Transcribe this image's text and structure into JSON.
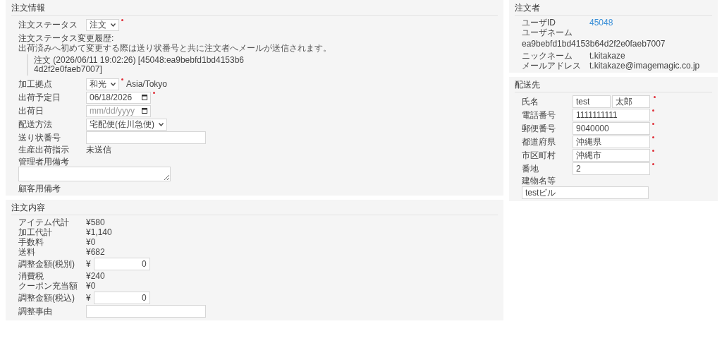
{
  "order_info": {
    "title": "注文情報",
    "fields": [
      {
        "kind": "select",
        "label": "注文ステータス",
        "value": "注文",
        "required": true
      },
      {
        "kind": "heading",
        "label": "注文ステータス変更履歴:"
      },
      {
        "kind": "note",
        "text": "出荷済みへ初めて変更する際は送り状番号と共に注文者へメールが送信されます。"
      },
      {
        "kind": "history",
        "text": "注文 (2026/06/11 19:02:26) [45048:ea9bebfd1bd4153b64d2f2e0faeb7007]"
      },
      {
        "kind": "select",
        "label": "加工拠点",
        "value": "和光",
        "required": true,
        "suffix": "Asia/Tokyo"
      },
      {
        "kind": "date",
        "label": "出荷予定日",
        "value": "06/18/2026",
        "required": true
      },
      {
        "kind": "date",
        "label": "出荷日",
        "placeholder": "mm/dd/yyyy",
        "required": false
      },
      {
        "kind": "select",
        "label": "配送方法",
        "value": "宅配便(佐川急便)",
        "required": false
      },
      {
        "kind": "input",
        "label": "送り状番号",
        "required": false
      },
      {
        "kind": "static",
        "label": "生産出荷指示",
        "value": "未送信"
      },
      {
        "kind": "textarea",
        "label": "管理者用備考"
      },
      {
        "kind": "heading",
        "label": "顧客用備考"
      }
    ]
  },
  "order_contents": {
    "title": "注文内容",
    "fields": [
      {
        "kind": "static",
        "label": "アイテム代計",
        "value": "¥580"
      },
      {
        "kind": "static",
        "label": "加工代計",
        "value": "¥1,140"
      },
      {
        "kind": "static",
        "label": "手数料",
        "value": "¥0"
      },
      {
        "kind": "static",
        "label": "送料",
        "value": "¥682"
      },
      {
        "kind": "money",
        "label": "調整金額(税別)",
        "prefix": "¥",
        "value": "0"
      },
      {
        "kind": "static",
        "label": "消費税",
        "value": "¥240"
      },
      {
        "kind": "static",
        "label": "クーポン充当額",
        "value": "¥0"
      },
      {
        "kind": "money",
        "label": "調整金額(税込)",
        "prefix": "¥",
        "value": "0"
      },
      {
        "kind": "input",
        "label": "調整事由",
        "required": false
      }
    ]
  },
  "orderer": {
    "title": "注文者",
    "fields": [
      {
        "kind": "link",
        "label": "ユーザID",
        "value": "45048"
      },
      {
        "kind": "stacked",
        "label": "ユーザネーム",
        "value": "ea9bebfd1bd4153b64d2f2e0faeb7007"
      },
      {
        "kind": "static",
        "label": "ニックネーム",
        "value": "t.kitakaze"
      },
      {
        "kind": "static",
        "label": "メールアドレス",
        "value": "t.kitakaze@imagemagic.co.jp"
      }
    ]
  },
  "shipping": {
    "title": "配送先",
    "fields": [
      {
        "kind": "name",
        "label": "氏名",
        "values": [
          "test",
          "太郎"
        ],
        "required": true
      },
      {
        "kind": "input",
        "label": "電話番号",
        "value": "1111111111",
        "required": true
      },
      {
        "kind": "input",
        "label": "郵便番号",
        "value": "9040000",
        "required": true
      },
      {
        "kind": "input",
        "label": "都道府県",
        "value": "沖縄県",
        "required": true
      },
      {
        "kind": "input",
        "label": "市区町村",
        "value": "沖縄市",
        "required": true
      },
      {
        "kind": "input",
        "label": "番地",
        "value": "2",
        "required": true
      },
      {
        "kind": "stacked-input",
        "label": "建物名等",
        "value": "testビル"
      }
    ]
  }
}
